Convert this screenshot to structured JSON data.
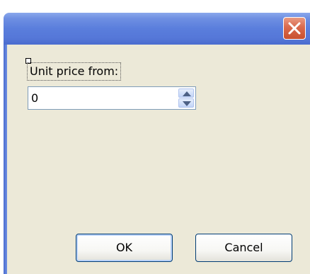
{
  "dialog": {
    "title": "",
    "unit_price_label": "Unit price from:",
    "unit_price_value": "0"
  },
  "buttons": {
    "ok_label": "OK",
    "cancel_label": "Cancel"
  },
  "icons": {
    "close": "close-icon",
    "spin_up": "arrow-up-icon",
    "spin_down": "arrow-down-icon"
  },
  "colors": {
    "titlebar": "#5a7edc",
    "close_button": "#d9694c",
    "dialog_background": "#ece9d8",
    "button_border": "#003c74"
  }
}
